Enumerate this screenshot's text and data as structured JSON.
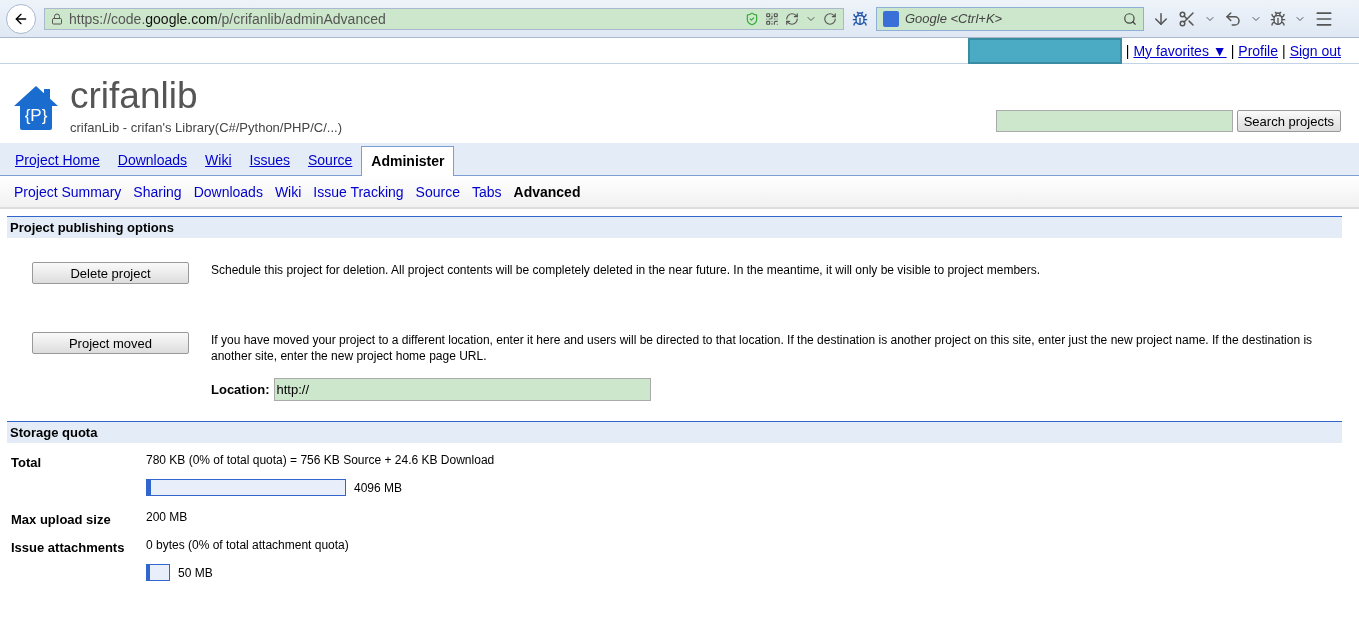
{
  "browser": {
    "url": "https://code.**google.com**/p/crifanlib/adminAdvanced",
    "search_placeholder": "Google <Ctrl+K>"
  },
  "user_bar": {
    "links": [
      {
        "separator": "|",
        "label": "My favorites ▼"
      },
      {
        "separator": "|",
        "label": "Profile"
      },
      {
        "separator": "|",
        "label": "Sign out"
      }
    ]
  },
  "project": {
    "logo_text": "{P}",
    "name": "crifanlib",
    "summary": "crifanLib - crifan's Library(C#/Python/PHP/C/...)",
    "search_button": "Search projects"
  },
  "tabs": [
    {
      "label": "Project Home",
      "selected": false
    },
    {
      "label": "Downloads",
      "selected": false
    },
    {
      "label": "Wiki",
      "selected": false
    },
    {
      "label": "Issues",
      "selected": false
    },
    {
      "label": "Source",
      "selected": false
    },
    {
      "label": "Administer",
      "selected": true
    }
  ],
  "subtabs": [
    {
      "label": "Project Summary",
      "selected": false
    },
    {
      "label": "Sharing",
      "selected": false
    },
    {
      "label": "Downloads",
      "selected": false
    },
    {
      "label": "Wiki",
      "selected": false
    },
    {
      "label": "Issue Tracking",
      "selected": false
    },
    {
      "label": "Source",
      "selected": false
    },
    {
      "label": "Tabs",
      "selected": false
    },
    {
      "label": "Advanced",
      "selected": true
    }
  ],
  "publishing": {
    "title": "Project publishing options",
    "actions": [
      {
        "button": "Delete project",
        "description": "Schedule this project for deletion. All project contents will be completely deleted in the near future. In the meantime, it will only be visible to project members."
      },
      {
        "button": "Project moved",
        "description": "If you have moved your project to a different location, enter it here and users will be directed to that location. If the destination is another project on this site, enter just the new project name. If the destination is another site, enter the new project home page URL.",
        "location_label": "Location:",
        "location_value": "http://"
      }
    ]
  },
  "storage": {
    "title": "Storage quota",
    "rows": [
      {
        "kind": "meter",
        "label": "Total",
        "text": "780 KB (0% of total quota)  = 756 KB Source + 24.6 KB Download",
        "level": 0.02,
        "limit": "4096 MB",
        "wide": true
      },
      {
        "kind": "text",
        "label": "Max upload size",
        "text": "200 MB"
      },
      {
        "kind": "meter",
        "label": "Issue attachments",
        "text": "0 bytes (0% of total attachment quota)",
        "level": 0.15,
        "limit": "50 MB",
        "wide": false
      }
    ]
  }
}
